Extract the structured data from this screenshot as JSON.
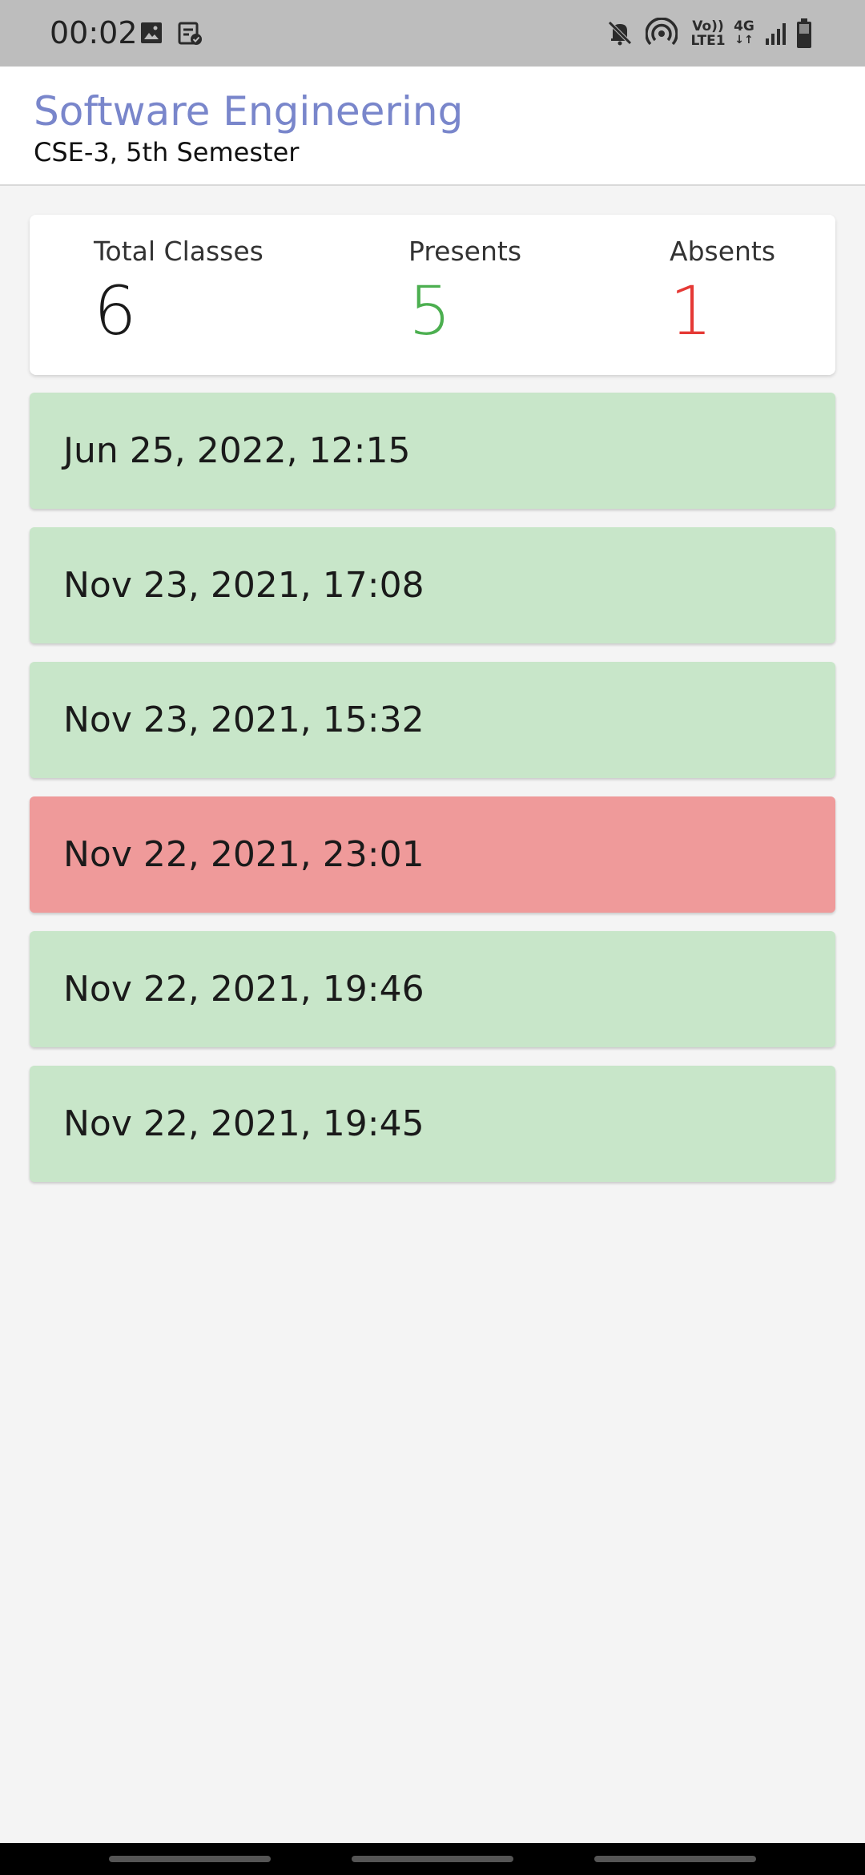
{
  "status_bar": {
    "time": "00:02",
    "left_icons": [
      "image-icon",
      "clipboard-check-icon"
    ],
    "right_icons": [
      "mute-icon",
      "hotspot-icon",
      "volte-icon",
      "4g-icon",
      "signal-icon",
      "battery-icon"
    ],
    "volte_line1": "Vo))",
    "volte_line2": "LTE1",
    "network_type": "4G"
  },
  "header": {
    "title": "Software Engineering",
    "subtitle": "CSE-3, 5th Semester",
    "title_color": "#7986cb"
  },
  "summary": {
    "total_label": "Total Classes",
    "total_value": "6",
    "presents_label": "Presents",
    "presents_value": "5",
    "absents_label": "Absents",
    "absents_value": "1",
    "present_color": "#4caf50",
    "absent_color": "#e53935"
  },
  "attendance": [
    {
      "date": "Jun 25, 2022, 12:15",
      "status": "present"
    },
    {
      "date": "Nov 23, 2021, 17:08",
      "status": "present"
    },
    {
      "date": "Nov 23, 2021, 15:32",
      "status": "present"
    },
    {
      "date": "Nov 22, 2021, 23:01",
      "status": "absent"
    },
    {
      "date": "Nov 22, 2021, 19:46",
      "status": "present"
    },
    {
      "date": "Nov 22, 2021, 19:45",
      "status": "present"
    }
  ],
  "colors": {
    "present_bg": "#c8e6c9",
    "absent_bg": "#ef9a9a"
  }
}
